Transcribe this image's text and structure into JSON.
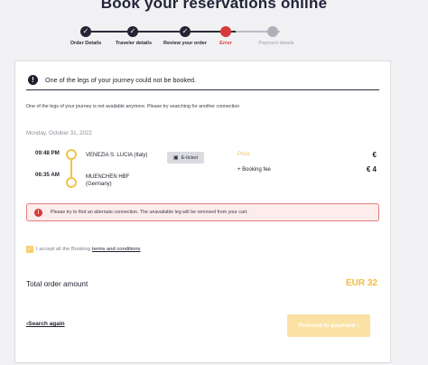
{
  "page": {
    "title": "Book your reservations online"
  },
  "stepper": {
    "steps": [
      {
        "label": "Order Details",
        "state": "done",
        "mark": "✓"
      },
      {
        "label": "Traveler details",
        "state": "done",
        "mark": "✓"
      },
      {
        "label": "Review your order",
        "state": "done",
        "mark": "✓"
      },
      {
        "label": "Error",
        "state": "error",
        "mark": ""
      },
      {
        "label": "Payment details",
        "state": "pending",
        "mark": ""
      }
    ]
  },
  "alert": {
    "icon": "exclamation-icon",
    "text": "One of the legs of your journey could not be booked."
  },
  "subnote": "One of the legs of your journey is not available anymore. Please try searching for another connection",
  "journey": {
    "date": "Monday, October 31, 2022",
    "departure": {
      "time": "09:48 PM",
      "station": "VENEZIA S. LUCIA (Italy)"
    },
    "arrival": {
      "time": "06:35 AM",
      "station_line1": "MUENCHEN HBF",
      "station_line2": "(Germany)"
    },
    "ticket_type": "E-ticket",
    "price_label": "Price",
    "price_value": "€",
    "fee_label": "+ Booking fee",
    "fee_value": "€ 4"
  },
  "error_box": {
    "icon": "exclamation-icon",
    "text": "Please try to find an alternate connection. The unavailable leg will be removed from your cart."
  },
  "terms": {
    "prefix": "I accept all the Booking",
    "link": "terms and conditions",
    "checked": true
  },
  "total": {
    "label": "Total order amount",
    "value": "EUR 32"
  },
  "actions": {
    "search_again": "Search again",
    "proceed": "Proceed to payment"
  },
  "colors": {
    "accent": "#f1bd3d",
    "error": "#d63a3a",
    "dark": "#242436"
  }
}
